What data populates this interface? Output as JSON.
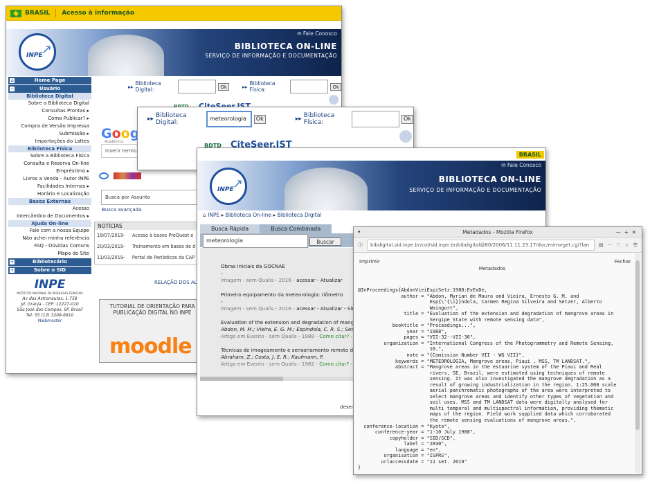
{
  "gov_bar": {
    "country": "BRASIL",
    "access_link": "Acesso à informação",
    "country_badge": "BRASIL"
  },
  "banner": {
    "contact": "Fale Conosco",
    "title": "BIBLIOTECA ON-LINE",
    "subtitle": "SERVIÇO DE INFORMAÇÃO E DOCUMENTAÇÃO",
    "logo_text": "INPE"
  },
  "search_bar": {
    "digital_label": "Biblioteca Digital:",
    "fisica_label": "Biblioteca Física:",
    "ok_label": "Ok",
    "query_value": "meteorologia"
  },
  "sidebar": [
    {
      "type": "header",
      "label": "Home Page",
      "icon": "home-icon"
    },
    {
      "type": "header",
      "label": "Usuário",
      "icon": "collapse-icon"
    },
    {
      "type": "section",
      "label": "Biblioteca Digital"
    },
    {
      "type": "item",
      "label": "Sobre a Biblioteca Digital"
    },
    {
      "type": "item",
      "label": "Consultas Prontas ▸"
    },
    {
      "type": "item",
      "label": "Como Publicar? ▸"
    },
    {
      "type": "item",
      "label": "Compra de Versão Impressa"
    },
    {
      "type": "item",
      "label": "Submissão ▸"
    },
    {
      "type": "item",
      "label": "Importações do Lattes"
    },
    {
      "type": "section",
      "label": "Biblioteca Física"
    },
    {
      "type": "item",
      "label": "Sobre a Biblioteca Física"
    },
    {
      "type": "item",
      "label": "Consulta e Reserva On-line"
    },
    {
      "type": "item",
      "label": "Empréstimo ▸"
    },
    {
      "type": "item",
      "label": "Livros a Venda - Autor INPE"
    },
    {
      "type": "item",
      "label": "Facilidades Internas ▸"
    },
    {
      "type": "item",
      "label": "Horário e Localização"
    },
    {
      "type": "section",
      "label": "Bases Externas"
    },
    {
      "type": "item",
      "label": "Acesso"
    },
    {
      "type": "item",
      "label": "Intercâmbio de Documentos ▸"
    },
    {
      "type": "section",
      "label": "Ajuda On-line"
    },
    {
      "type": "item",
      "label": "Fale com a nossa Equipe"
    },
    {
      "type": "item",
      "label": "Não achei minha referência"
    },
    {
      "type": "item",
      "label": "FAQ - Dúvidas Comuns"
    },
    {
      "type": "item",
      "label": "Mapa do Site"
    },
    {
      "type": "header",
      "label": "Bibliotecário",
      "icon": "expand-icon"
    },
    {
      "type": "header",
      "label": "Sobre o SID",
      "icon": "expand-icon"
    }
  ],
  "inpe_info": {
    "name": "INPE",
    "full": "INSTITUTO NACIONAL DE PESQUISAS ESPACIAIS",
    "addr1": "Av dos Astronautas, 1.758",
    "addr2": "Jd. Granja - CEP: 12227-010",
    "city": "São José dos Campos, SP, Brasil",
    "tel": "Tel: 55 (12) 3208-6910",
    "webmaster": "Webmaster"
  },
  "main": {
    "bdtd": "BDTD",
    "citeseer": "CiteSeer.IST",
    "google": "Google",
    "google_sub": "Acadêmico",
    "google_placeholder": "Inserir termo",
    "busca_placeholder": "Busca por Assunto",
    "busca_avancada": "Busca avançada",
    "news_title": "NOTÍCIAS",
    "news": [
      {
        "date": "18/07/2019-",
        "text": "Acesso à bases ProQuest e"
      },
      {
        "date": "20/03/2019-",
        "text": "Treinamento em bases de d"
      },
      {
        "date": "11/03/2019-",
        "text": "Portal de Periódicos da CAP"
      }
    ],
    "relacao": "RELAÇÃO DOS ALU",
    "tutorial": "TUTORIAL DE ORIENTAÇÃO PARA PUBLICAÇÃO DIGITAL NO INPE",
    "moodle": "moodle"
  },
  "w3": {
    "breadcrumb": [
      "INPE",
      "Biblioteca On-line",
      "Biblioteca Digital"
    ],
    "tabs": [
      "Busca Rápida",
      "Busca Combinada"
    ],
    "query": "meteorologia",
    "buscar": "Buscar",
    "footer": "desen",
    "results": [
      {
        "title": "Obras iniciais da GOCNAE",
        "authors": "-",
        "meta": "Imagem - sem Qualis - 2016 - ",
        "links": "acessar - Atualizar"
      },
      {
        "title": "Primeiro equipamento da meteorologia: riômetro",
        "authors": "-",
        "meta": "Imagem - sem Qualis - 2016 - ",
        "links": "acessar - Atualizar - Simi"
      },
      {
        "title": "Evaluation of the extension and degradation of mangrove",
        "authors": "Abdon, M. M.; Vieira, E. G. M.; Espíndola, C. R. S.; Setz",
        "meta": "Artigo em Evento - sem Qualis - 1988 - ",
        "links": "Como citar? - Bib"
      },
      {
        "title": "Técnicas de imageamento e sensoriamento remoto de obj",
        "authors": "Abraham, Z.; Costa, J. E. R.; Kaufmann, P.",
        "meta": "Artigo em Evento - sem Qualis - 1982 - ",
        "links": "Como citar? - Bib"
      }
    ]
  },
  "firefox": {
    "title": "Metadados - Mozilla Firefox",
    "url": "bibdigital.sid.inpe.br/col/sid.inpe.br/bibdigital@80/2006/11.11.23.17/doc/mirrorget.cgi?lan",
    "imprimir": "Imprimir",
    "fechar": "Fechar",
    "heading": "Metadados",
    "record": "@InProceedings{AbdonVieiEspiSetz:1988:EvExDe,\n               author = \"Abdon, Myrian de Moura and Vieira, Ernesto G. M. and\n                         Esp{\\'{\\i}}ndola, Carmen Regina Silveira and Setzer, Alberto\n                         Waingort\",\n                title = \"Evaluation of the extension and degradation of mangrove areas in\n                         Sergipe State with remote sensing data\",\n            booktitle = \"Proceedings...\",\n                 year = \"1988\",\n                pages = \"VII-32--VII-36\",\n         organization = \"International Congress of the Photogrammetry and Remote Sensing,\n                         16.\",\n                 note = \"{Comission Number VII - WG VII}\",\n             keywords = \"METEOROLOGIA, Mangrove areas, Piaui , MSS, TM LANDSAT.\",\n             abstract = \"Mangrove areas in the estuarine system of the Piaui and Real\n                         rivers, SE, Brazil, were estimated using techniques of remote\n                         sensing. It was also investigated the mangrove degradation as a\n                         result of growing industrialization in the region. 1:25.000 scale\n                         aerial panchromatic photographs of the area were interpreted to\n                         select mangrove areas and identify other types of vegetation and\n                         soil uses. MSS and TM LANDSAT data were digitally analysed for\n                         multi temporal and multispectral information, providing thematic\n                         maps of the region. Field work supplied data which corroborated\n                         the remote sensing evaluations of mangrove areas.\",\n  conference-location = \"Kyoto\",\n      conference-year = \"1-10 July 1988\",\n           copyholder = \"SID/SCD\",\n                label = \"2830\",\n             language = \"en\",\n         organisation = \"ISPRS\",\n        urlaccessdate = \"11 set. 2019\"\n}"
  }
}
